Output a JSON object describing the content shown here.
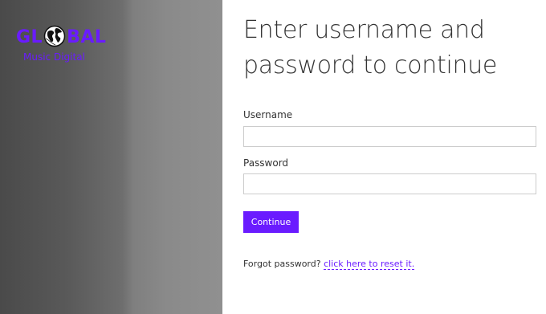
{
  "brand": {
    "logo_left": "GL",
    "logo_right": "BAL",
    "tagline": "Music Digital",
    "color": "#6a1bff"
  },
  "login": {
    "heading": "Enter username and password to continue",
    "username_label": "Username",
    "username_value": "",
    "password_label": "Password",
    "password_value": "",
    "continue_label": "Continue",
    "forgot_text": "Forgot password?",
    "reset_link_text": "click here to reset it."
  },
  "icons": {
    "globe": "globe-icon"
  },
  "colors": {
    "accent": "#6a1bff",
    "text": "#333333",
    "input_border": "#cccccc",
    "panel_dark": "#4a4a4a",
    "panel_light": "#909090"
  }
}
